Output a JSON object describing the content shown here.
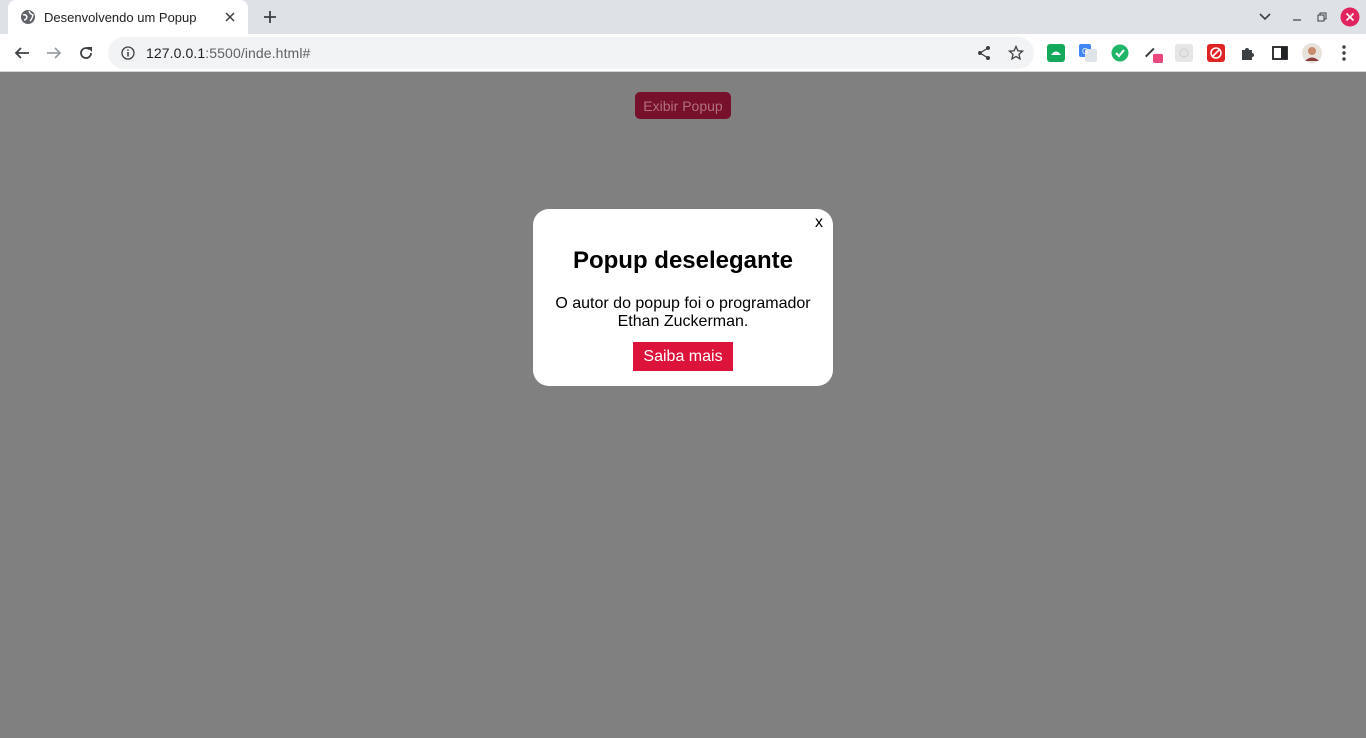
{
  "browser": {
    "tab": {
      "title": "Desenvolvendo um Popup"
    },
    "address": {
      "host": "127.0.0.1",
      "path": ":5500/inde.html#"
    },
    "colors": {
      "tabstrip": "#dee1e6",
      "toolbar": "#ffffff",
      "omnibox": "#f1f3f4"
    },
    "extensions": [
      "green-extension-icon",
      "translate-icon",
      "green-circle-extension-icon",
      "eyedropper-icon",
      "gray-extension-icon",
      "red-extension-icon",
      "puzzle-icon",
      "sidepanel-icon",
      "profile-avatar"
    ]
  },
  "page": {
    "background": "#808080",
    "show_button": {
      "label": "Exibir Popup",
      "color": "#77102a"
    },
    "popup": {
      "close_label": "x",
      "title": "Popup deselegante",
      "text": "O autor do popup foi o programador Ethan Zuckerman.",
      "button_label": "Saiba mais",
      "button_color": "#dc143c"
    }
  }
}
